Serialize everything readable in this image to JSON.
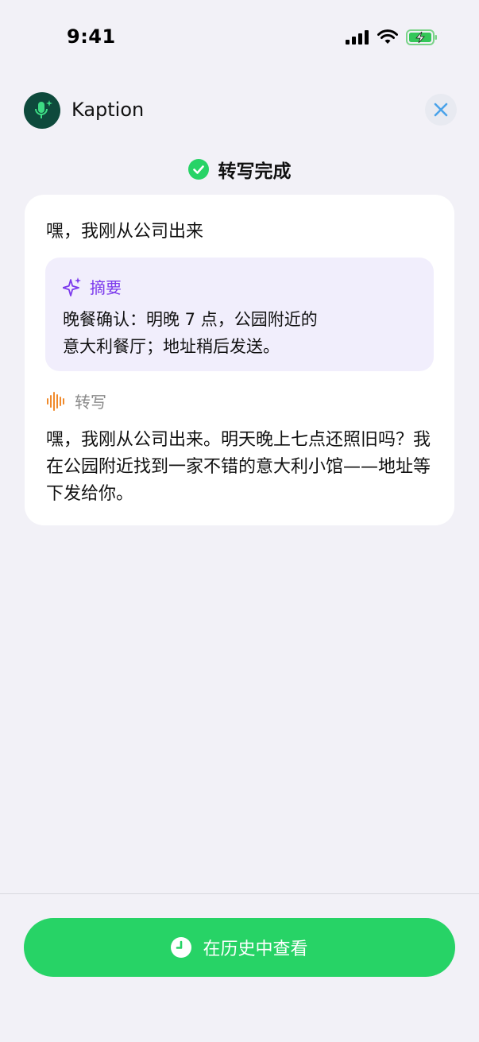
{
  "status_bar": {
    "time": "9:41"
  },
  "header": {
    "app_name": "Kaption"
  },
  "status": {
    "text": "转写完成"
  },
  "card": {
    "title": "嘿，我刚从公司出来",
    "summary": {
      "label": "摘要",
      "text": "晚餐确认：明晚 7 点，公园附近的\n意大利餐厅；地址稍后发送。"
    },
    "transcript": {
      "label": "转写",
      "text": "嘿，我刚从公司出来。明天晚上七点还照旧吗？我在公园附近找到一家不错的意大利小馆——地址等下发给你。"
    }
  },
  "footer": {
    "history_button": "在历史中查看"
  },
  "colors": {
    "accent_green": "#27d366",
    "summary_purple": "#7c3aed",
    "transcript_orange": "#f08a2c",
    "close_blue": "#4aa3ea"
  }
}
